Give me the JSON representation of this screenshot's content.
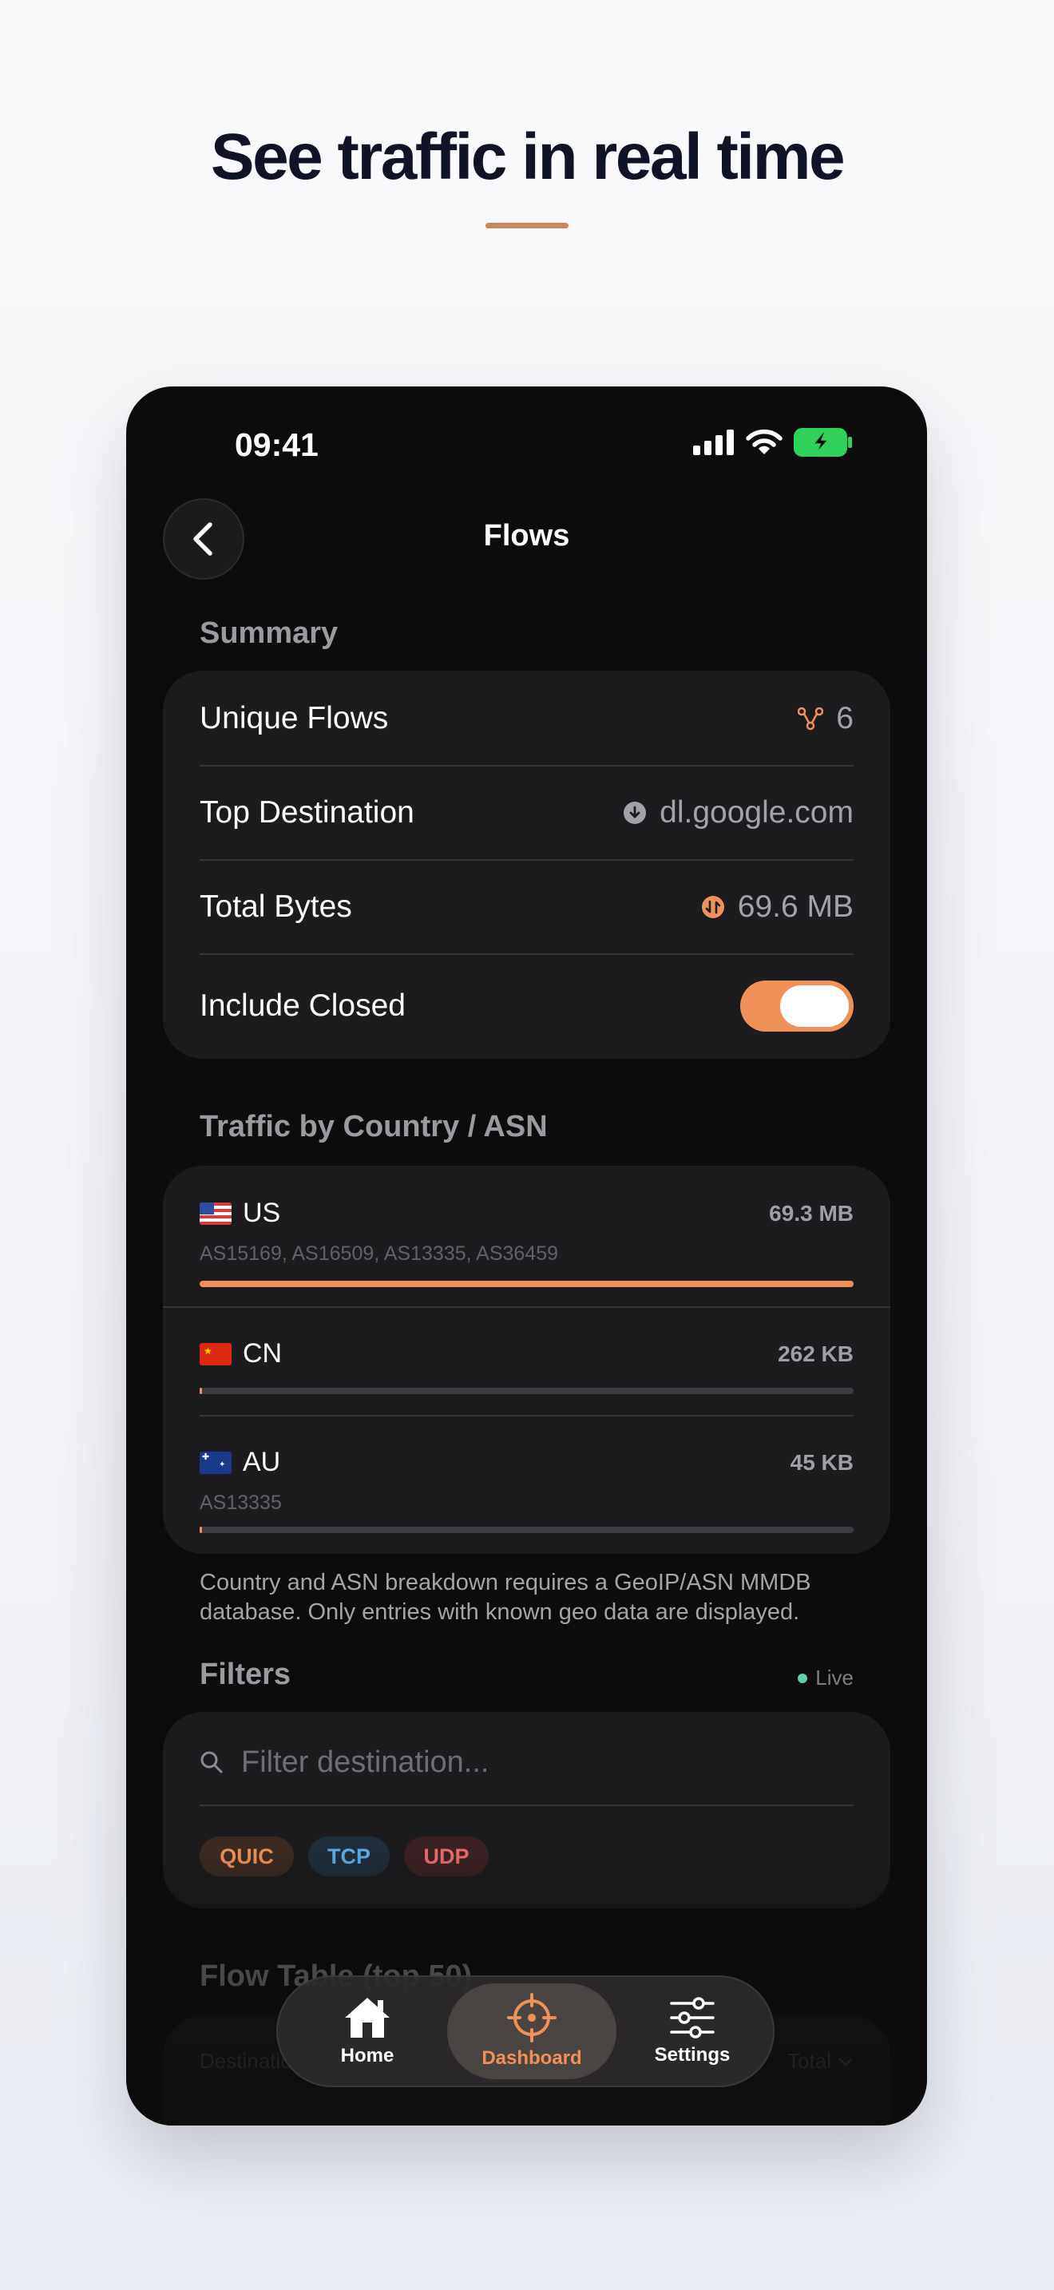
{
  "headline": "See traffic in real time",
  "status_bar": {
    "time": "09:41"
  },
  "nav": {
    "title": "Flows"
  },
  "summary": {
    "header": "Summary",
    "unique_flows": {
      "label": "Unique Flows",
      "value": "6"
    },
    "top_destination": {
      "label": "Top Destination",
      "value": "dl.google.com"
    },
    "total_bytes": {
      "label": "Total Bytes",
      "value": "69.6 MB"
    },
    "include_closed": {
      "label": "Include Closed",
      "on": true
    }
  },
  "traffic": {
    "header": "Traffic by Country / ASN",
    "countries": [
      {
        "code": "US",
        "bytes": "69.3 MB",
        "asn": "AS15169, AS16509, AS13335, AS36459",
        "share": 1.0
      },
      {
        "code": "CN",
        "bytes": "262 KB",
        "asn": "",
        "share": 0.004
      },
      {
        "code": "AU",
        "bytes": "45 KB",
        "asn": "AS13335",
        "share": 0.001
      }
    ],
    "note": "Country and ASN breakdown requires a GeoIP/ASN MMDB database. Only entries with known geo data are displayed."
  },
  "filters": {
    "header": "Filters",
    "live": "Live",
    "placeholder": "Filter destination...",
    "chips": [
      "QUIC",
      "TCP",
      "UDP"
    ]
  },
  "flow_table": {
    "header": "Flow Table (top 50)",
    "col_destination": "Destination",
    "col_total": "Total"
  },
  "tabbar": {
    "home": "Home",
    "dashboard": "Dashboard",
    "settings": "Settings",
    "active": "Dashboard"
  },
  "colors": {
    "accent": "#ef9158",
    "quic": "#ef9158",
    "tcp": "#5aaee6",
    "udp": "#ea6c6c",
    "battery": "#30d158"
  }
}
